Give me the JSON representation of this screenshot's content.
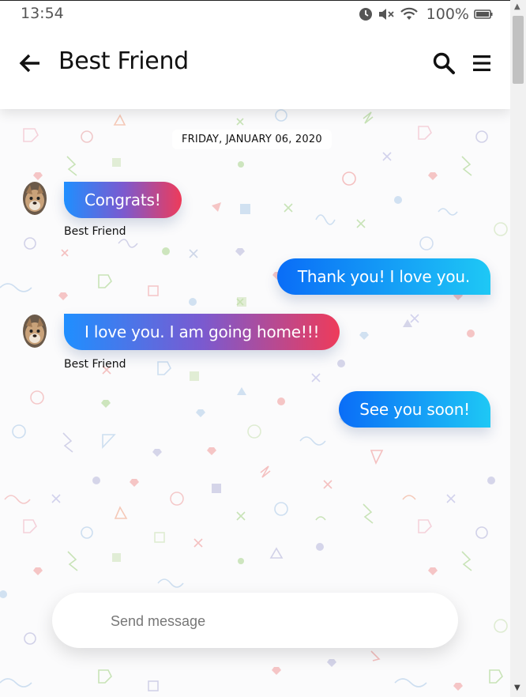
{
  "status_bar": {
    "time": "13:54",
    "battery_percent": "100%",
    "icons": [
      "alarm-icon",
      "mute-icon",
      "wifi-icon",
      "battery-icon"
    ]
  },
  "header": {
    "title": "Best Friend",
    "back_icon": "arrow-left-icon",
    "search_icon": "search-icon",
    "menu_icon": "hamburger-menu-icon"
  },
  "chat": {
    "date_label": "FRIDAY, JANUARY 06, 2020",
    "messages": [
      {
        "direction": "incoming",
        "text": "Congrats!",
        "sender": "Best Friend"
      },
      {
        "direction": "outgoing",
        "text": "Thank you! I love you."
      },
      {
        "direction": "incoming",
        "text": "I love you. I am going home!!!",
        "sender": "Best Friend"
      },
      {
        "direction": "outgoing",
        "text": "See you soon!"
      }
    ]
  },
  "composer": {
    "placeholder": "Send message",
    "value": ""
  },
  "colors": {
    "incoming_gradient": [
      "#1f8fff",
      "#7a5ad0",
      "#ee3b5a"
    ],
    "outgoing_gradient": [
      "#0a6df7",
      "#1ec8f5"
    ],
    "background": "#fbfbfc"
  }
}
